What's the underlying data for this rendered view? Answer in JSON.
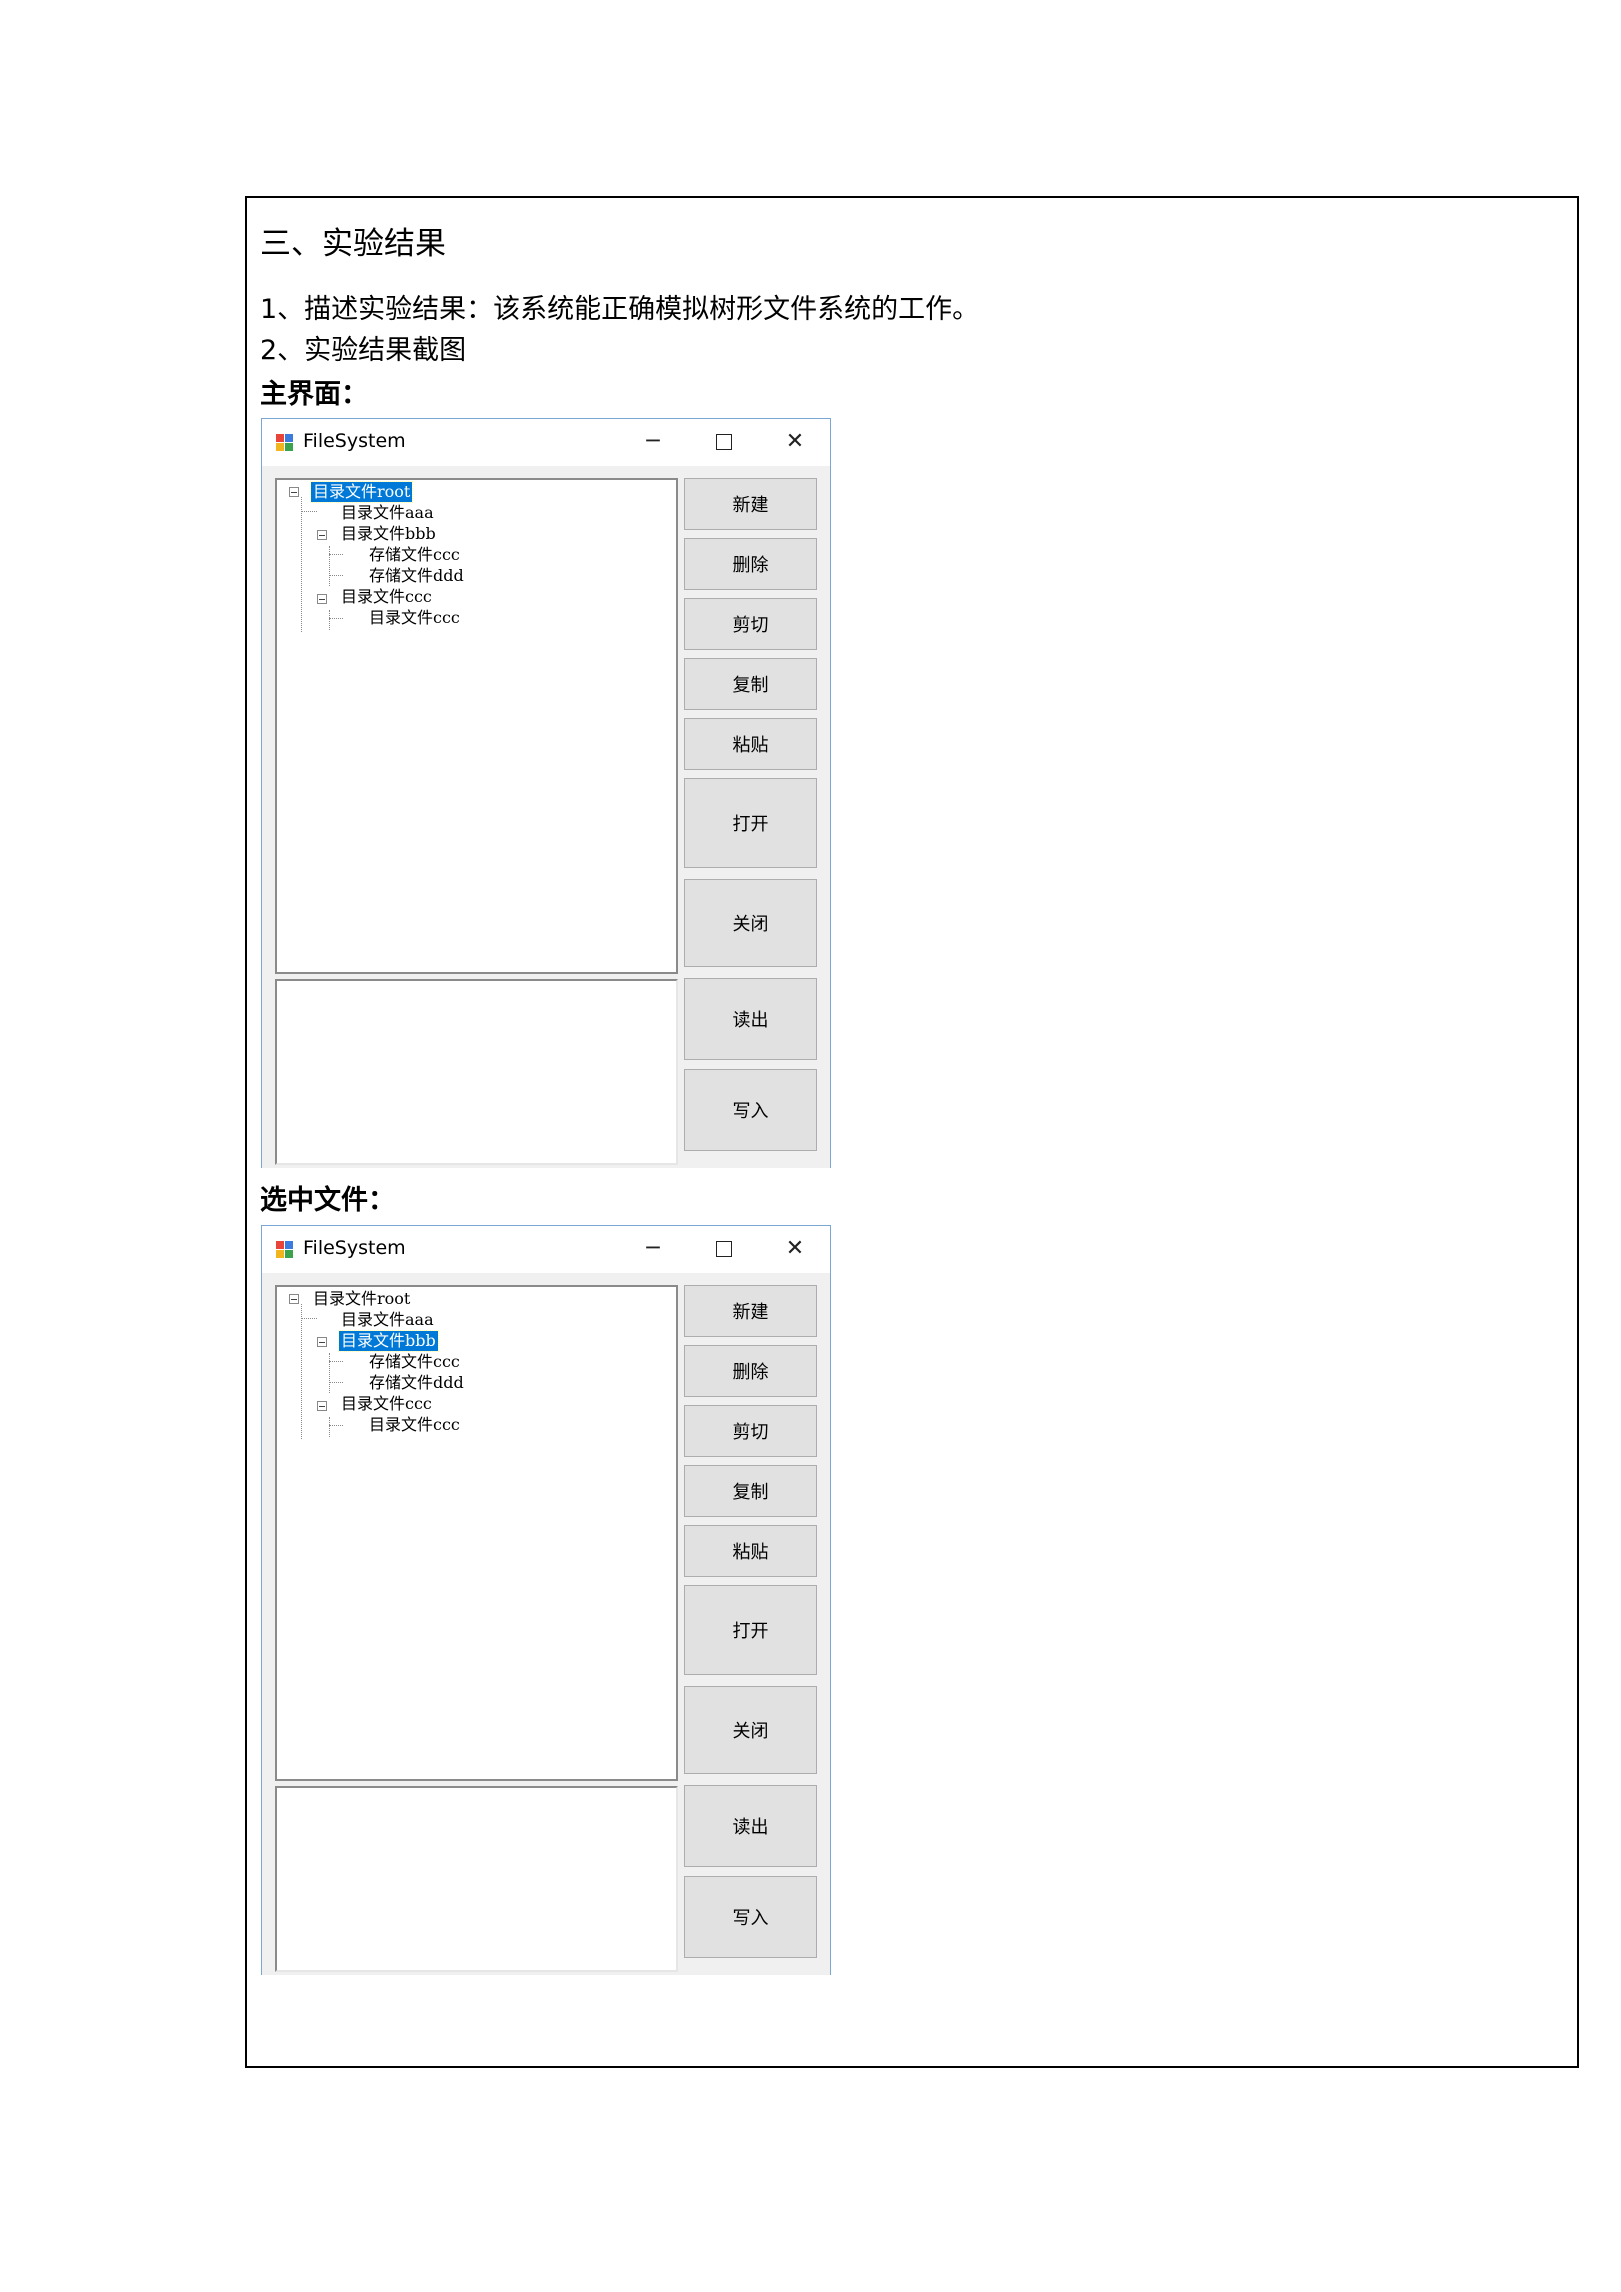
{
  "section_heading": "三、实验结果",
  "description": "1、描述实验结果：该系统能正确模拟树形文件系统的工作。",
  "screenshot_heading": "2、实验结果截图",
  "figures": [
    {
      "caption": "主界面：",
      "window": {
        "title": "FileSystem",
        "controls": {
          "minimize": "─",
          "close": "✕"
        },
        "tree": [
          {
            "label": "目录文件root",
            "selected": true
          },
          {
            "label": "目录文件aaa"
          },
          {
            "label": "目录文件bbb"
          },
          {
            "label": "存储文件ccc"
          },
          {
            "label": "存储文件ddd"
          },
          {
            "label": "目录文件ccc"
          },
          {
            "label": "目录文件ccc"
          }
        ],
        "buttons": [
          "新建",
          "删除",
          "剪切",
          "复制",
          "粘贴",
          "打开",
          "关闭",
          "读出",
          "写入"
        ]
      }
    },
    {
      "caption": "选中文件：",
      "window": {
        "title": "FileSystem",
        "controls": {
          "minimize": "─",
          "close": "✕"
        },
        "tree": [
          {
            "label": "目录文件root"
          },
          {
            "label": "目录文件aaa"
          },
          {
            "label": "目录文件bbb",
            "selected": true
          },
          {
            "label": "存储文件ccc"
          },
          {
            "label": "存储文件ddd"
          },
          {
            "label": "目录文件ccc"
          },
          {
            "label": "目录文件ccc"
          }
        ],
        "buttons": [
          "新建",
          "删除",
          "剪切",
          "复制",
          "粘贴",
          "打开",
          "关闭",
          "读出",
          "写入"
        ]
      }
    }
  ]
}
